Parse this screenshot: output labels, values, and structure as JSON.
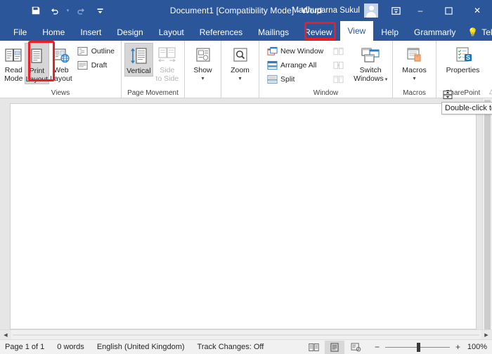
{
  "window": {
    "title": "Document1 [Compatibility Mode]  -  Word",
    "user_name": "Madhuparna Sukul",
    "quick_access": [
      {
        "name": "save",
        "label": "Save"
      },
      {
        "name": "undo",
        "label": "Undo"
      },
      {
        "name": "redo",
        "label": "Redo"
      },
      {
        "name": "customize-qat",
        "label": "Customize Quick Access Toolbar"
      }
    ],
    "controls": {
      "ribbon_display_options": "Ribbon Display Options",
      "minimize": "–",
      "maximize": "☐",
      "close": "✕"
    }
  },
  "ribbon": {
    "tabs": [
      {
        "label": "File",
        "active": false
      },
      {
        "label": "Home",
        "active": false
      },
      {
        "label": "Insert",
        "active": false
      },
      {
        "label": "Design",
        "active": false
      },
      {
        "label": "Layout",
        "active": false
      },
      {
        "label": "References",
        "active": false
      },
      {
        "label": "Mailings",
        "active": false
      },
      {
        "label": "Review",
        "active": false
      },
      {
        "label": "View",
        "active": true
      },
      {
        "label": "Help",
        "active": false
      },
      {
        "label": "Grammarly",
        "active": false
      }
    ],
    "tell_me": "Tell me",
    "groups": [
      {
        "name": "views",
        "label": "Views",
        "buttons": [
          {
            "label_line1": "Read",
            "label_line2": "Mode",
            "state": "normal"
          },
          {
            "label_line1": "Print",
            "label_line2": "Layout",
            "state": "selected"
          },
          {
            "label_line1": "Web",
            "label_line2": "Layout",
            "state": "normal"
          }
        ],
        "small_buttons": [
          {
            "label": "Outline",
            "state": "normal"
          },
          {
            "label": "Draft",
            "state": "normal"
          }
        ]
      },
      {
        "name": "page-movement",
        "label": "Page Movement",
        "buttons": [
          {
            "label_line1": "Vertical",
            "label_line2": "",
            "state": "selected"
          },
          {
            "label_line1": "Side",
            "label_line2": "to Side",
            "state": "disabled"
          }
        ]
      },
      {
        "name": "show",
        "label": "",
        "buttons": [
          {
            "label_line1": "Show",
            "label_line2": "",
            "state": "normal",
            "dropdown": true
          }
        ]
      },
      {
        "name": "zoom",
        "label": "",
        "buttons": [
          {
            "label_line1": "Zoom",
            "label_line2": "",
            "state": "normal",
            "dropdown": true
          }
        ]
      },
      {
        "name": "window",
        "label": "Window",
        "small_buttons": [
          {
            "label": "New Window",
            "state": "normal"
          },
          {
            "label": "Arrange All",
            "state": "normal"
          },
          {
            "label": "Split",
            "state": "normal"
          }
        ],
        "small_buttons_2": [
          {
            "label": "",
            "state": "disabled",
            "icon": "view-side-by-side-icon"
          },
          {
            "label": "",
            "state": "disabled",
            "icon": "synchronous-scrolling-icon"
          },
          {
            "label": "",
            "state": "disabled",
            "icon": "reset-window-position-icon"
          }
        ],
        "buttons": [
          {
            "label_line1": "Switch",
            "label_line2": "Windows",
            "state": "normal",
            "dropdown": true
          }
        ]
      },
      {
        "name": "macros",
        "label": "Macros",
        "buttons": [
          {
            "label_line1": "Macros",
            "label_line2": "",
            "state": "normal",
            "dropdown": true
          }
        ]
      },
      {
        "name": "sharepoint",
        "label": "SharePoint",
        "buttons": [
          {
            "label_line1": "Properties",
            "label_line2": "",
            "state": "normal"
          }
        ]
      }
    ]
  },
  "tooltip": {
    "text": "Double-click to"
  },
  "status_bar": {
    "page": "Page 1 of 1",
    "words": "0 words",
    "language": "English (United Kingdom)",
    "track_changes": "Track Changes: Off",
    "view_buttons": [
      {
        "name": "read-mode-view-button",
        "active": false
      },
      {
        "name": "print-layout-view-button",
        "active": true
      },
      {
        "name": "web-layout-view-button",
        "active": false
      }
    ],
    "zoom_out": "−",
    "zoom_in": "+",
    "zoom_level": "100%"
  },
  "colors": {
    "brand_blue": "#2b579a",
    "annotation_red": "#ee1c25",
    "canvas_gray": "#e6e6e6"
  }
}
